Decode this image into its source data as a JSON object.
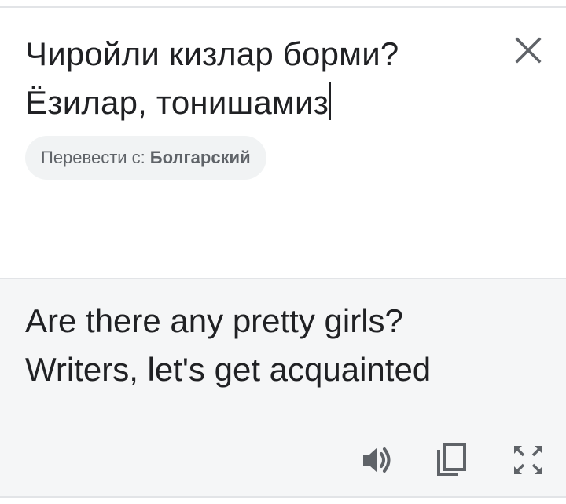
{
  "source": {
    "lines": [
      "Чиройли кизлар борми?",
      "Ёзилар, тонишамиз"
    ]
  },
  "detect_chip": {
    "prefix": "Перевести с:",
    "language": "Болгарский"
  },
  "result": {
    "lines": [
      "Are there any pretty girls?",
      "Writers, let's get acquainted"
    ]
  },
  "icons": {
    "close": "close-icon",
    "speaker": "volume-icon",
    "copy": "copy-icon",
    "fullscreen": "fullscreen-icon"
  },
  "colors": {
    "text": "#202124",
    "icon": "#5f6368",
    "chip_bg": "#f1f3f4",
    "result_bg": "#f5f6f7",
    "divider": "#e2e4e7"
  }
}
